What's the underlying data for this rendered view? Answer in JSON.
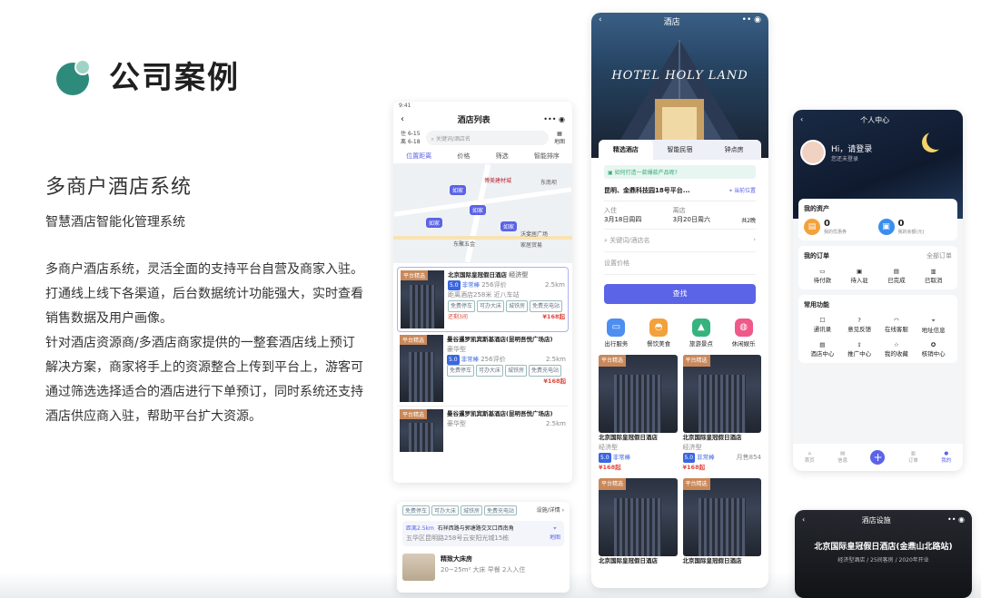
{
  "left": {
    "title": "公司案例",
    "system_name": "多商户酒店系统",
    "subtitle": "智慧酒店智能化管理系统",
    "paragraphs": [
      "多商户酒店系统，灵活全面的支持平台自营及商家入驻。打通线上线下各渠道，后台数据统计功能强大，实时查看销售数据及用户画像。",
      "针对酒店资源商/多酒店商家提供的一整套酒店线上预订解决方案，商家将手上的资源整合上传到平台上，游客可通过筛选选择适合的酒店进行下单预订，同时系统还支持酒店供应商入驻，帮助平台扩大资源。"
    ]
  },
  "list_phone": {
    "status_time": "9:41",
    "title": "酒店列表",
    "date_in": "6-15",
    "date_out": "6-18",
    "date_in_label": "住",
    "date_out_label": "离",
    "search_placeholder": "关键词/酒店名",
    "map_label": "地图",
    "filters": [
      "位置距离",
      "价格",
      "筛选",
      "智能排序"
    ],
    "map_pins": [
      "如家",
      "如家",
      "如家",
      "如家"
    ],
    "map_labels": [
      "博美建材城",
      "东南坝",
      "东聚五金",
      "沃斐居广场",
      "家居贸易"
    ],
    "hotels": [
      {
        "tag": "平台精选",
        "name": "北京国际皇冠假日酒店",
        "type": "经济型",
        "score": "5.0",
        "score_label": "非常棒",
        "reviews": "256评价",
        "distance": "2.5km",
        "sub": "距离酒店258米  近八车站",
        "tags": [
          "免费停车",
          "可办大床",
          "城铁房",
          "免费充电站"
        ],
        "extra": "还剩3间",
        "price": "¥168起"
      },
      {
        "tag": "平台精选",
        "name": "曼谷暹罗凯宾斯基酒店(昆明吾悦广场店)",
        "type": "豪华型",
        "score": "5.0",
        "score_label": "非常棒",
        "reviews": "256评价",
        "distance": "2.5km",
        "sub": "",
        "tags": [
          "免费停车",
          "可办大床",
          "城铁房",
          "免费充电站"
        ],
        "extra": "",
        "price": "¥168起"
      },
      {
        "tag": "平台精选",
        "name": "曼谷暹罗凯宾斯基酒店(昆明吾悦广场店)",
        "type": "豪华型",
        "score": "",
        "score_label": "",
        "reviews": "",
        "distance": "2.5km",
        "sub": "",
        "tags": [],
        "extra": "",
        "price": ""
      }
    ]
  },
  "detail_card": {
    "tags": [
      "免费停车",
      "可办大床",
      "城铁房",
      "免费充电站"
    ],
    "link": "设施/详情",
    "distance_label": "距离2.5km",
    "address": "石祥西路与郭塘路交叉口西南角",
    "address2": "五华区昆明路258号云安阳光城15栋",
    "map_label": "地图",
    "room_name": "精致大床房",
    "room_info": "20~25m²  大床  早餐  2人入住"
  },
  "home_phone": {
    "header_title": "酒店",
    "banner_text": "HOTEL HOLY LAND",
    "tabs": [
      "精选酒店",
      "智能民宿",
      "钟点房"
    ],
    "notice": "如何打造一款爆款产品呢?",
    "location": "昆明、金鼎科技园18号平台...",
    "location_action": "当前位置",
    "checkin_label": "入住",
    "checkin": "3月18日周四",
    "checkout_label": "离店",
    "checkout": "3月20日周六",
    "nights": "共2晚",
    "search_placeholder": "关键词/酒店名",
    "price_placeholder": "设置价格",
    "search_button": "查找",
    "services": [
      "出行服务",
      "餐饮美食",
      "旅游景点",
      "休闲娱乐"
    ],
    "cards": [
      {
        "tag": "平台精选",
        "name": "北京国际皇冠假日酒店",
        "type": "经济型",
        "score": "5.0",
        "score_label": "非常棒",
        "extra": "",
        "price": "¥168起"
      },
      {
        "tag": "平台精选",
        "name": "北京国际皇冠假日酒店",
        "type": "经济型",
        "score": "5.0",
        "score_label": "非常棒",
        "extra": "月售854",
        "price": "¥168起"
      },
      {
        "tag": "平台精选",
        "name": "北京国际皇冠假日酒店",
        "type": "",
        "score": "",
        "score_label": "",
        "extra": "",
        "price": ""
      },
      {
        "tag": "平台精选",
        "name": "北京国际皇冠假日酒店",
        "type": "",
        "score": "",
        "score_label": "",
        "extra": "",
        "price": ""
      }
    ]
  },
  "profile_phone": {
    "title": "个人中心",
    "greeting": "Hi，请登录",
    "greeting_sub": "您还未登录",
    "assets_title": "我的资产",
    "asset1_value": "0",
    "asset1_label": "我的优惠券",
    "asset2_value": "0",
    "asset2_label": "我的余额(元)",
    "orders_title": "我的订单",
    "orders_all": "全部订单",
    "orders": [
      "待付款",
      "待入驻",
      "已完成",
      "已取消"
    ],
    "functions_title": "常用功能",
    "functions": [
      "通讯录",
      "意见反馈",
      "在线客服",
      "地址信息",
      "酒店中心",
      "推广中心",
      "我的收藏",
      "核销中心"
    ],
    "nav": [
      "首页",
      "信息",
      "",
      "订单",
      "我的"
    ]
  },
  "facility_phone": {
    "title": "酒店设施",
    "hotel_name": "北京国际皇冠假日酒店(金鼎山北路站)",
    "hotel_sub": "经济型酒店 / 25间客房 / 2020年开业"
  },
  "colors": {
    "accent": "#5b63e6",
    "teal": "#2e8b7c",
    "price": "#e2483d",
    "orange": "#f39c2a"
  }
}
